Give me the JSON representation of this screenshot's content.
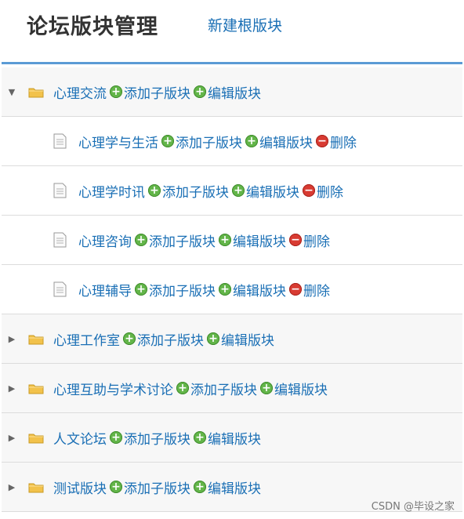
{
  "header": {
    "title": "论坛版块管理",
    "new_root_label": "新建根版块"
  },
  "tree": [
    {
      "name": "心理交流",
      "level": 0,
      "expanded": true,
      "add_label": "添加子版块",
      "edit_label": "编辑版块",
      "delete_label": ""
    },
    {
      "name": "心理学与生活",
      "level": 1,
      "add_label": "添加子版块",
      "edit_label": "编辑版块",
      "delete_label": "删除"
    },
    {
      "name": "心理学时讯",
      "level": 1,
      "add_label": "添加子版块",
      "edit_label": "编辑版块",
      "delete_label": "删除"
    },
    {
      "name": "心理咨询",
      "level": 1,
      "add_label": "添加子版块",
      "edit_label": "编辑版块",
      "delete_label": "删除"
    },
    {
      "name": "心理辅导",
      "level": 1,
      "add_label": "添加子版块",
      "edit_label": "编辑版块",
      "delete_label": "删除"
    },
    {
      "name": "心理工作室",
      "level": 0,
      "expanded": false,
      "add_label": "添加子版块",
      "edit_label": "编辑版块",
      "delete_label": ""
    },
    {
      "name": "心理互助与学术讨论",
      "level": 0,
      "expanded": false,
      "add_label": "添加子版块",
      "edit_label": "编辑版块",
      "delete_label": ""
    },
    {
      "name": "人文论坛",
      "level": 0,
      "expanded": false,
      "add_label": "添加子版块",
      "edit_label": "编辑版块",
      "delete_label": ""
    },
    {
      "name": "测试版块",
      "level": 0,
      "expanded": false,
      "add_label": "添加子版块",
      "edit_label": "编辑版块",
      "delete_label": ""
    }
  ],
  "icons": {
    "folder": "folder-icon",
    "document": "document-icon",
    "add": "add-circle-icon",
    "edit": "edit-circle-icon",
    "delete": "delete-circle-icon",
    "expand": "triangle-expand-icon"
  },
  "colors": {
    "link": "#1a6fb5",
    "accent_line": "#5b9bd5",
    "green": "#63b549",
    "red": "#d83b32",
    "folder": "#f2c24b"
  },
  "watermark": "CSDN @毕设之家"
}
